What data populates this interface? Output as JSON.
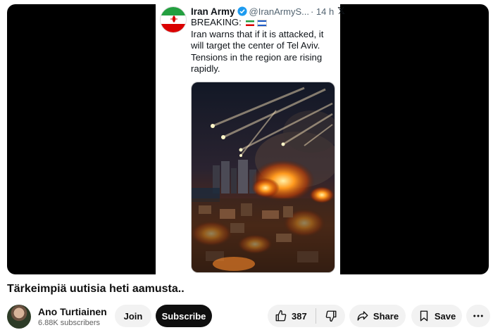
{
  "tweet": {
    "name": "Iran Army",
    "handle": "@IranArmyS...",
    "time": "· 14 h",
    "x_icon": "𝕏",
    "breaking": "BREAKING:",
    "text": "Iran warns that if it is attacked, it will target the center of Tel Aviv. Tensions in the region are rising rapidly."
  },
  "video": {
    "title": "Tärkeimpiä uutisia heti aamusta.."
  },
  "channel": {
    "name": "Ano Turtiainen",
    "subscribers": "6.88K subscribers"
  },
  "actions": {
    "join_label": "Join",
    "subscribe_label": "Subscribe",
    "like_count": "387",
    "share_label": "Share",
    "save_label": "Save"
  },
  "colors": {
    "accent": "#0f0f0f",
    "verified": "#1d9bf0",
    "pill_bg": "#f2f2f2"
  }
}
